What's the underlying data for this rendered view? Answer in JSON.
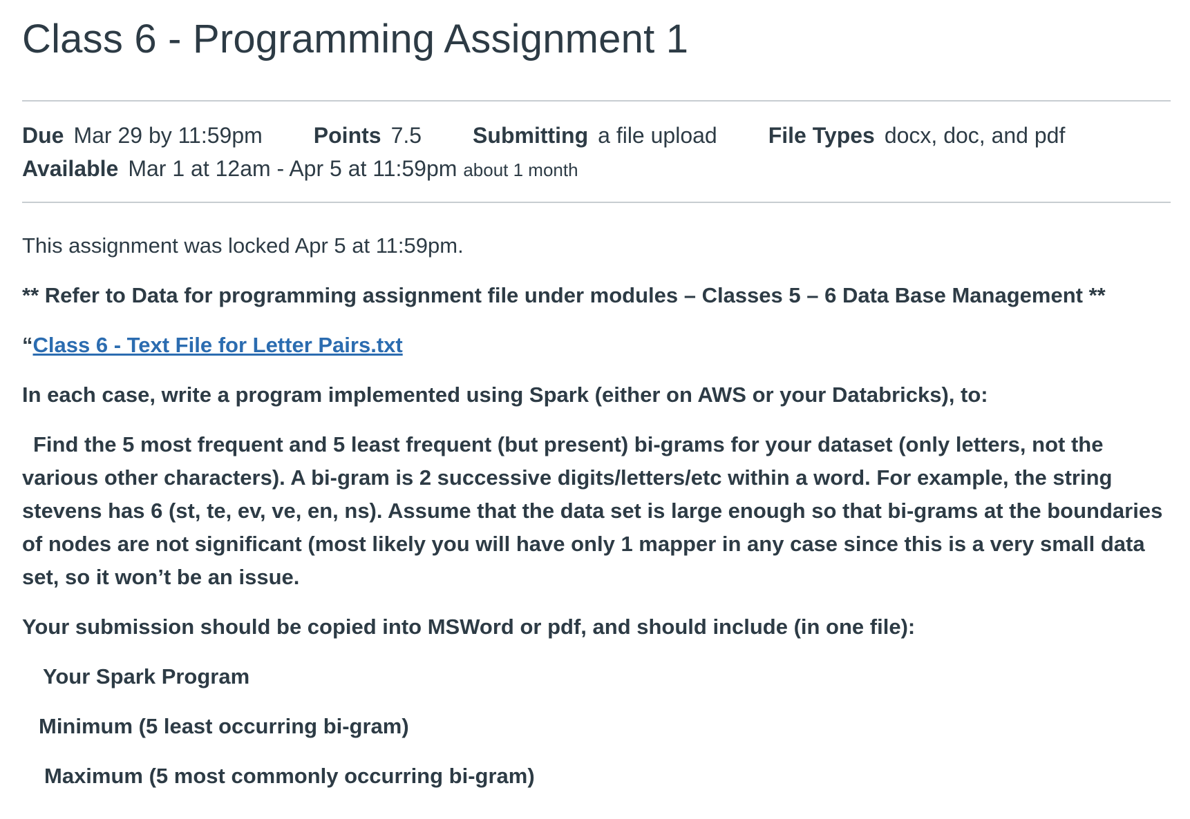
{
  "page": {
    "title": "Class 6 - Programming Assignment 1"
  },
  "details": {
    "due_label": "Due",
    "due_value": "Mar 29 by 11:59pm",
    "points_label": "Points",
    "points_value": "7.5",
    "submitting_label": "Submitting",
    "submitting_value": "a file upload",
    "filetypes_label": "File Types",
    "filetypes_value": "docx, doc, and pdf",
    "available_label": "Available",
    "available_value": "Mar 1 at 12am - Apr 5 at 11:59pm",
    "available_duration": "about 1 month"
  },
  "content": {
    "locked_notice": "This assignment was locked Apr 5 at 11:59pm.",
    "refer_note": "** Refer to Data for programming assignment file under modules – Classes 5 – 6   Data Base Management **",
    "quote_mark": "“",
    "file_link": "Class 6 - Text File for Letter Pairs.txt",
    "instructions_intro": "In each case, write a program implemented using Spark (either on AWS or your Databricks),  to:",
    "task_description": "Find the 5 most frequent and 5 least frequent (but present)  bi-grams for your dataset (only letters, not the various other characters).  A bi-gram is 2 successive digits/letters/etc within a word.  For example, the string stevens has 6 (st, te, ev, ve, en, ns).  Assume that the data set is large enough so that bi-grams at the boundaries of nodes are not significant (most likely you will have only 1 mapper in any case since this is a very small data set, so it won’t be an issue.",
    "submission_intro": "Your submission should be copied into MSWord or pdf, and should include (in one file):",
    "items": [
      "Your Spark Program",
      "Minimum (5 least occurring bi-gram)",
      "Maximum (5 most commonly occurring bi-gram)"
    ]
  }
}
